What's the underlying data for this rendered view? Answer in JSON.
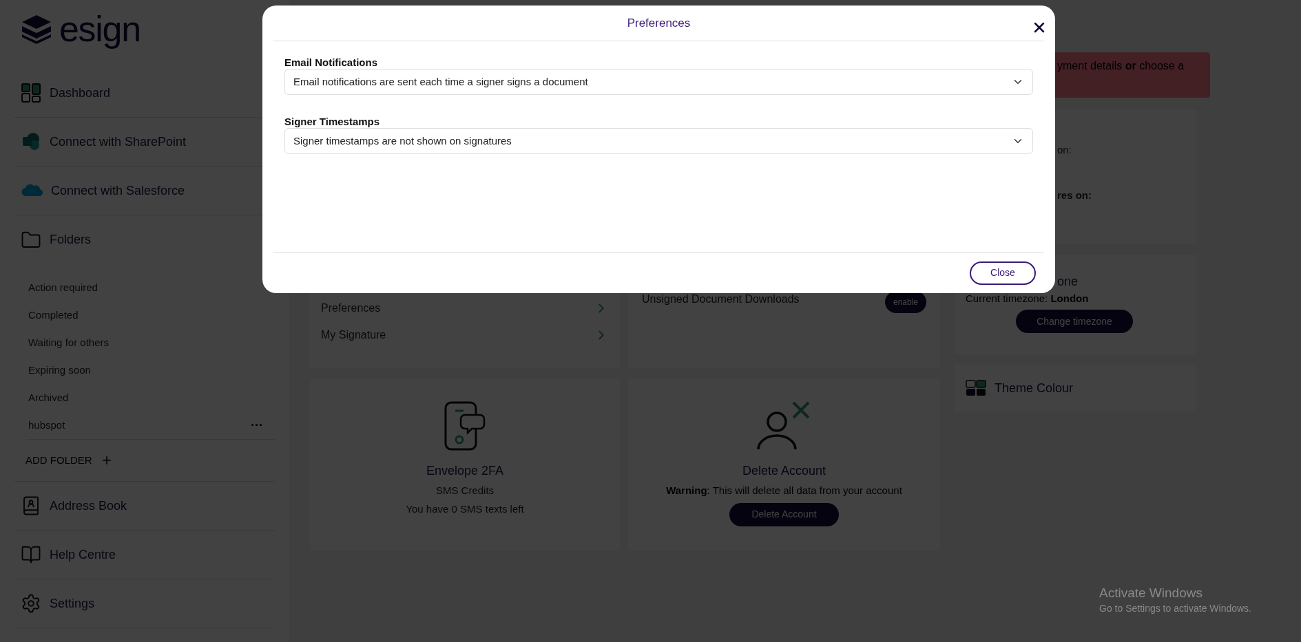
{
  "sidebar": {
    "logo": "esign",
    "top_items": [
      {
        "label": "Dashboard"
      },
      {
        "label": "Connect with SharePoint"
      },
      {
        "label": "Connect with Salesforce"
      },
      {
        "label": "Folders"
      }
    ],
    "folders": [
      {
        "label": "Action required"
      },
      {
        "label": "Completed"
      },
      {
        "label": "Waiting for others"
      },
      {
        "label": "Expiring soon"
      },
      {
        "label": "Archived"
      },
      {
        "label": "hubspot",
        "menu": "···"
      }
    ],
    "add_folder": "ADD FOLDER",
    "bottom_items": [
      {
        "label": "Address Book"
      },
      {
        "label": "Help Centre"
      },
      {
        "label": "Settings"
      }
    ]
  },
  "background": {
    "banner": {
      "link_1": "yment details",
      "joiner": "or",
      "link_2": "choose a"
    },
    "account_card": {
      "line_1": "on:",
      "line_2": "res on:"
    },
    "timezone_card": {
      "title": "one",
      "label": "Current timezone:",
      "value": "London",
      "button": "Change timezone"
    },
    "theme_card": {
      "title": "Theme Colour"
    },
    "settings_links": [
      {
        "label": "Preferences"
      },
      {
        "label": "My Signature"
      }
    ],
    "downloads": {
      "label": "Unsigned Document Downloads",
      "button": "enable"
    },
    "envelope_2fa": {
      "title": "Envelope 2FA",
      "subtitle": "SMS Credits",
      "note": "You have 0 SMS texts left"
    },
    "delete_account": {
      "title": "Delete Account",
      "warning": "**Warning**: This will delete all data from your account",
      "button": "Delete Account"
    }
  },
  "dialog": {
    "title": "Preferences",
    "fields": [
      {
        "label": "Email Notifications",
        "value": "Email notifications are sent each time a signer signs a document"
      },
      {
        "label": "Signer Timestamps",
        "value": "Signer timestamps are not shown on signatures"
      }
    ],
    "close_button": "Close"
  },
  "os_notice": {
    "title": "Activate Windows",
    "text": "Go to Settings to activate Windows."
  }
}
